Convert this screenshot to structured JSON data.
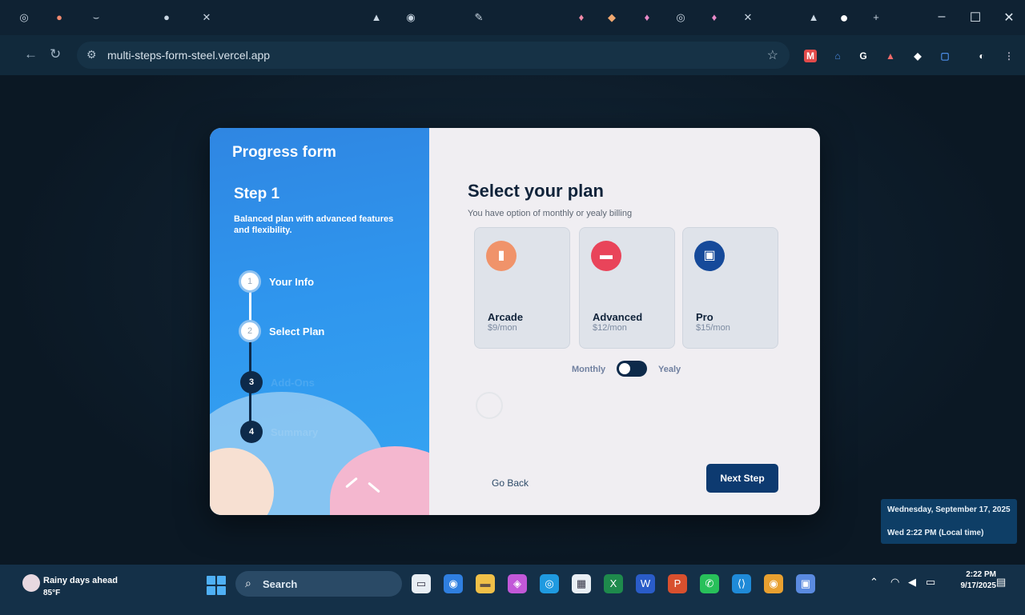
{
  "browser": {
    "url": "multi-steps-form-steel.vercel.app",
    "window_controls": {
      "minimize": "–",
      "maximize": "☐",
      "close": "✕"
    }
  },
  "sidebar": {
    "brand": "Progress form",
    "step_title": "Step 1",
    "step_desc": "Balanced plan with advanced features and flexibility.",
    "steps": [
      {
        "num": "1",
        "label": "Your Info"
      },
      {
        "num": "2",
        "label": "Select Plan"
      },
      {
        "num": "3",
        "label": "Add-Ons"
      },
      {
        "num": "4",
        "label": "Summary"
      }
    ]
  },
  "main": {
    "title": "Select your plan",
    "subtitle": "You have option of monthly or yealy billing",
    "plans": [
      {
        "name": "Arcade",
        "price": "$9/mon",
        "color": "#f0936a"
      },
      {
        "name": "Advanced",
        "price": "$12/mon",
        "color": "#e9445a"
      },
      {
        "name": "Pro",
        "price": "$15/mon",
        "color": "#164a9a"
      }
    ],
    "billing_monthly": "Monthly",
    "billing_yearly": "Yealy",
    "go_back": "Go Back",
    "next": "Next Step"
  },
  "notification": {
    "date": "Wednesday, September 17, 2025",
    "time": "Wed 2:22 PM (Local time)"
  },
  "taskbar": {
    "weather_title": "Rainy days ahead",
    "weather_temp": "85°F",
    "search": "Search",
    "clock_time": "2:22 PM",
    "clock_date": "9/17/2025"
  }
}
